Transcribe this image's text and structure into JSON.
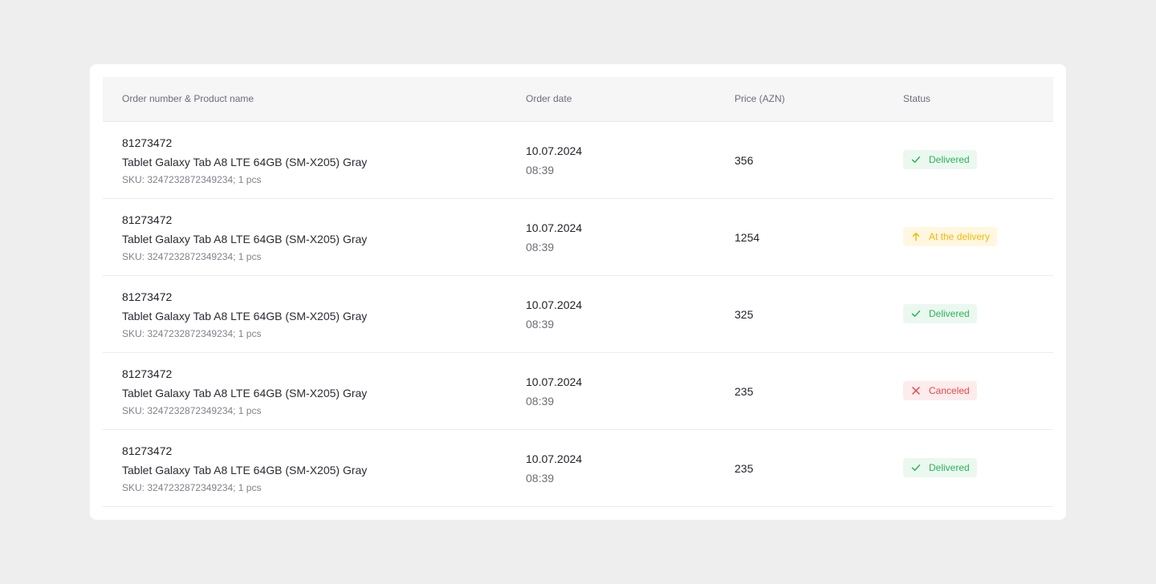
{
  "table": {
    "headers": {
      "order": "Order number & Product name",
      "date": "Order date",
      "price": "Price (AZN)",
      "status": "Status"
    },
    "rows": [
      {
        "order_number": "81273472",
        "product": "Tablet Galaxy Tab A8 LTE 64GB (SM-X205) Gray",
        "sku": "SKU: 3247232872349234; 1 pcs",
        "date": "10.07.2024",
        "time": "08:39",
        "price": "356",
        "status": "Delivered",
        "status_type": "delivered"
      },
      {
        "order_number": "81273472",
        "product": "Tablet Galaxy Tab A8 LTE 64GB (SM-X205) Gray",
        "sku": "SKU: 3247232872349234; 1 pcs",
        "date": "10.07.2024",
        "time": "08:39",
        "price": "1254",
        "status": "At the delivery",
        "status_type": "delivery"
      },
      {
        "order_number": "81273472",
        "product": "Tablet Galaxy Tab A8 LTE 64GB (SM-X205) Gray",
        "sku": "SKU: 3247232872349234; 1 pcs",
        "date": "10.07.2024",
        "time": "08:39",
        "price": "325",
        "status": "Delivered",
        "status_type": "delivered"
      },
      {
        "order_number": "81273472",
        "product": "Tablet Galaxy Tab A8 LTE 64GB (SM-X205) Gray",
        "sku": "SKU: 3247232872349234; 1 pcs",
        "date": "10.07.2024",
        "time": "08:39",
        "price": "235",
        "status": "Canceled",
        "status_type": "canceled"
      },
      {
        "order_number": "81273472",
        "product": "Tablet Galaxy Tab A8 LTE 64GB (SM-X205) Gray",
        "sku": "SKU: 3247232872349234; 1 pcs",
        "date": "10.07.2024",
        "time": "08:39",
        "price": "235",
        "status": "Delivered",
        "status_type": "delivered"
      }
    ]
  },
  "status_icons": {
    "delivered": "check-icon",
    "delivery": "arrow-up-icon",
    "canceled": "close-icon"
  },
  "colors": {
    "delivered": "#2bb35a",
    "delivery": "#f2b90c",
    "canceled": "#e5484d"
  }
}
